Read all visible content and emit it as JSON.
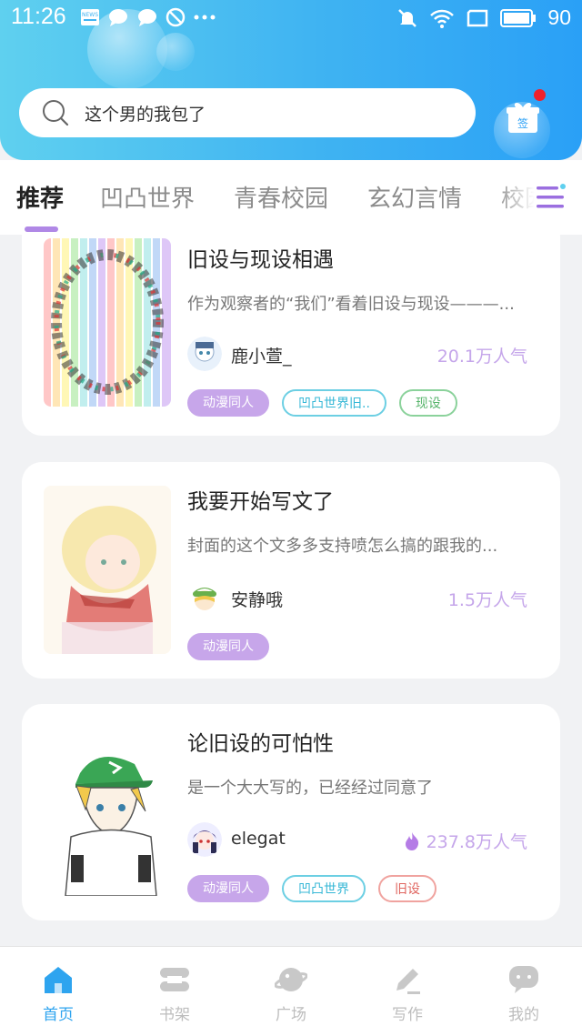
{
  "status_bar": {
    "time": "11:26",
    "news_label": "NEWS",
    "battery": "90",
    "icons": [
      "news-icon",
      "chat-icon",
      "chat-icon",
      "block-icon",
      "more-dots-icon",
      "mute-icon",
      "wifi-icon",
      "screen-icon",
      "battery-icon"
    ]
  },
  "search": {
    "placeholder": "这个男的我包了"
  },
  "checkin": {
    "label": "签",
    "has_badge": true
  },
  "tabs": [
    {
      "label": "推荐",
      "active": true
    },
    {
      "label": "凹凸世界",
      "active": false
    },
    {
      "label": "青春校园",
      "active": false
    },
    {
      "label": "玄幻言情",
      "active": false
    },
    {
      "label": "校园",
      "active": false
    }
  ],
  "cards": [
    {
      "title": "旧设与现设相遇",
      "description": "作为观察者的“我们”看着旧设与现设———...",
      "author": "鹿小萱_",
      "popularity": "20.1万人气",
      "hot": false,
      "tags": [
        {
          "label": "动漫同人",
          "style": "purple"
        },
        {
          "label": "凹凸世界旧..",
          "style": "cyan"
        },
        {
          "label": "现设",
          "style": "green"
        }
      ]
    },
    {
      "title": "我要开始写文了",
      "description": "封面的这个文多多支持喷怎么搞的跟我的...",
      "author": "安静哦",
      "popularity": "1.5万人气",
      "hot": false,
      "tags": [
        {
          "label": "动漫同人",
          "style": "purple"
        }
      ]
    },
    {
      "title": "论旧设的可怕性",
      "description": "是一个大大写的，已经经过同意了",
      "author": "elegat",
      "popularity": "237.8万人气",
      "hot": true,
      "tags": [
        {
          "label": "动漫同人",
          "style": "purple"
        },
        {
          "label": "凹凸世界",
          "style": "cyan"
        },
        {
          "label": "旧设",
          "style": "red"
        }
      ]
    }
  ],
  "bottom_nav": [
    {
      "label": "首页",
      "icon": "home-icon",
      "active": true
    },
    {
      "label": "书架",
      "icon": "bookshelf-icon",
      "active": false
    },
    {
      "label": "广场",
      "icon": "planet-icon",
      "active": false
    },
    {
      "label": "写作",
      "icon": "pen-icon",
      "active": false
    },
    {
      "label": "我的",
      "icon": "profile-chat-icon",
      "active": false
    }
  ],
  "colors": {
    "header_gradient_start": "#5fd0ef",
    "header_gradient_end": "#2aa0f6",
    "accent_purple": "#c7a6ea",
    "tab_underline": "#b088e6",
    "active_nav": "#2ea4ef",
    "badge_red": "#f0212b"
  }
}
